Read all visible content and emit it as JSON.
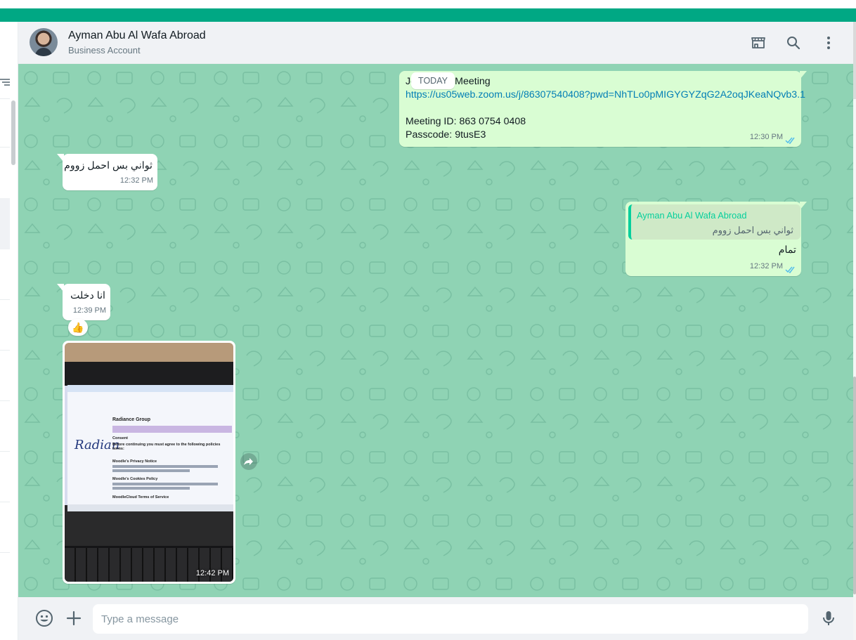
{
  "colors": {
    "accent": "#00a884",
    "outgoing_bubble": "#d9fdd3",
    "incoming_bubble": "#ffffff",
    "chat_background": "#8fd3b4",
    "read_ticks": "#53bdeb",
    "link": "#027eb5"
  },
  "header": {
    "contact_name": "Ayman Abu Al Wafa Abroad",
    "contact_subtitle": "Business Account",
    "icons": [
      "catalog-icon",
      "search-icon",
      "menu-icon"
    ]
  },
  "chat": {
    "date_divider": "TODAY",
    "messages": [
      {
        "direction": "out",
        "line1": "Join Zoom Meeting",
        "link": "https://us05web.zoom.us/j/86307540408?pwd=NhTLo0pMIGYGYZqG2A2oqJKeaNQvb3.1",
        "line3": "Meeting ID: 863 0754 0408",
        "line4": "Passcode: 9tusE3",
        "time": "12:30 PM",
        "status": "read"
      },
      {
        "direction": "in",
        "text": "ثواني بس احمل زووم",
        "time": "12:32 PM"
      },
      {
        "direction": "out",
        "quoted_name": "Ayman Abu Al Wafa Abroad",
        "quoted_text": "ثواني بس احمل زووم",
        "text": "تمام",
        "time": "12:32 PM",
        "status": "read"
      },
      {
        "direction": "in",
        "text": "انا دخلت",
        "time": "12:39 PM",
        "reaction": "👍"
      },
      {
        "direction": "in",
        "type": "image",
        "time": "12:42 PM",
        "image_text": {
          "page_title": "Radiance Group",
          "logo": "Radian",
          "consent": "Consent",
          "consent_body": "Before continuing you must agree to the following policies terms:",
          "privacy": "Moodle's Privacy Notice",
          "cookies": "Moodle's Cookies Policy",
          "terms": "MoodleCloud Terms of Service"
        }
      }
    ]
  },
  "footer": {
    "placeholder": "Type a message",
    "value": ""
  }
}
